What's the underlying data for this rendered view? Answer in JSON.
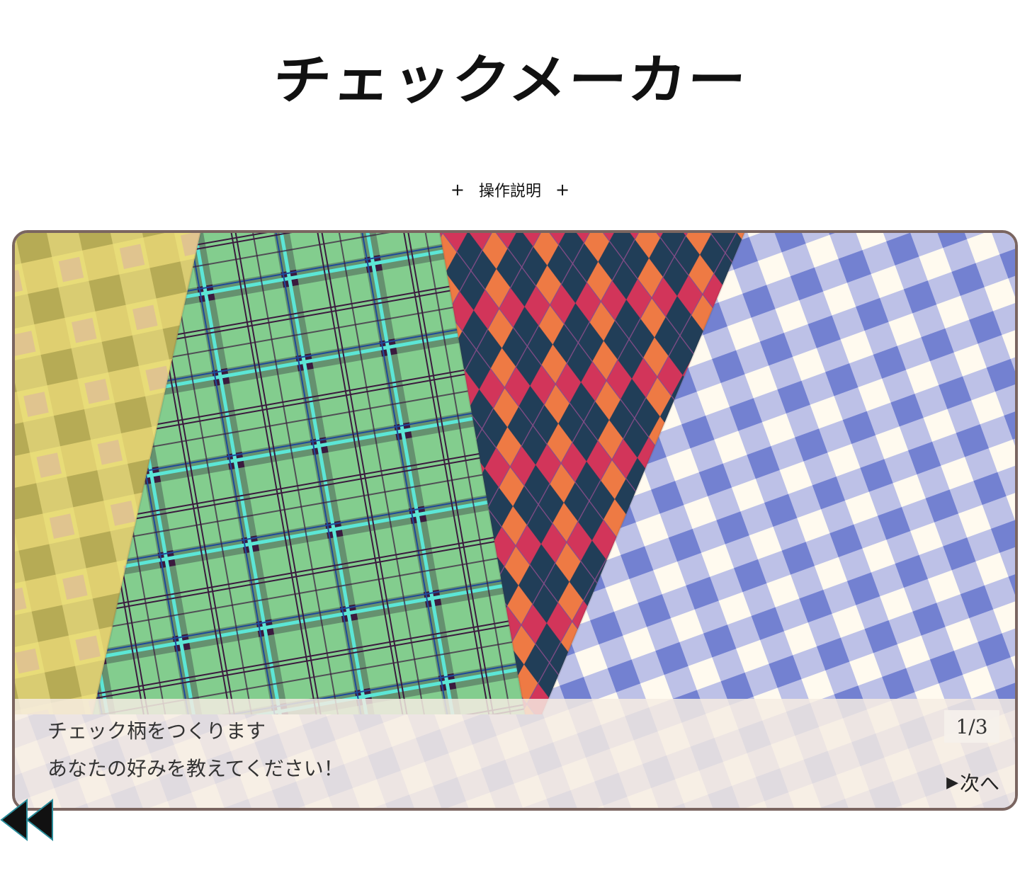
{
  "app": {
    "title": "チェックメーカー"
  },
  "help": {
    "prefix": "+",
    "label": "操作説明",
    "suffix": "+"
  },
  "dialog": {
    "line1": "チェック柄をつくります",
    "line2": "あなたの好みを教えてください！",
    "page": "1/3",
    "next_label": "次へ"
  },
  "icons": {
    "rewind": "rewind-icon",
    "next": "play-triangle-icon"
  },
  "colors": {
    "frame_border": "#7a6560",
    "yellow_plaid": "#e8dc78",
    "green_plaid": "#7fc98b",
    "argyle_red": "#d2355a",
    "argyle_orange": "#ee7a44",
    "argyle_navy": "#213e58",
    "gingham_blue": "#7381d1",
    "gingham_cream": "#fffaef"
  }
}
